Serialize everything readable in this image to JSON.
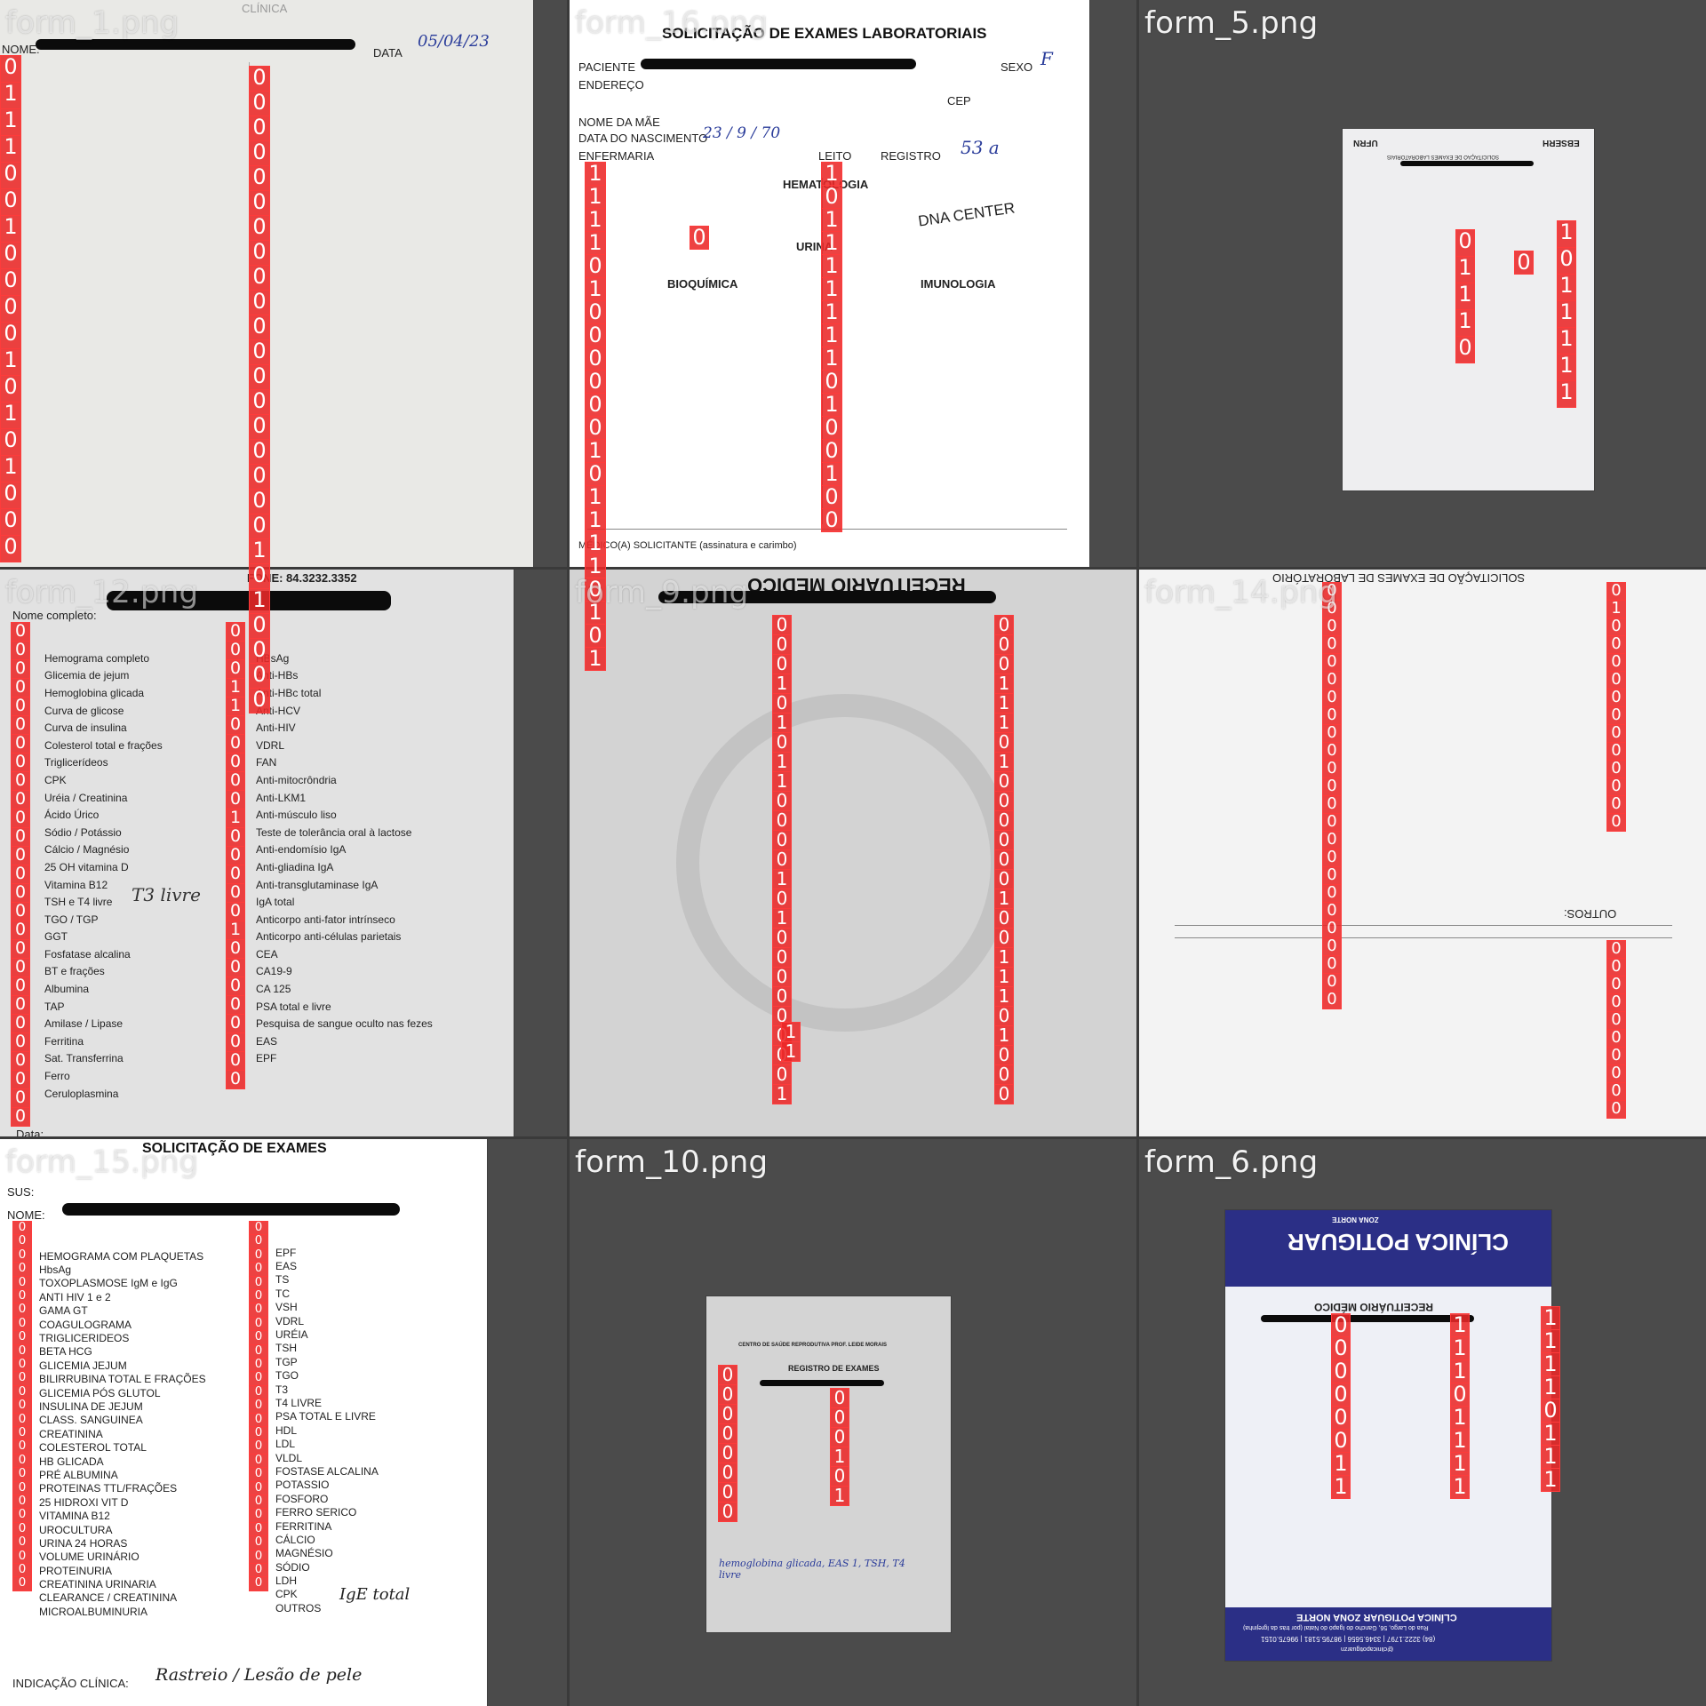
{
  "tiles": [
    {
      "name": "form_1.png",
      "header": {
        "name_label": "NOME:",
        "date_label": "DATA",
        "date_value": "05/04/23",
        "org": "CLÍNICA"
      }
    },
    {
      "name": "form_16.png",
      "title": "SOLICITAÇÃO DE EXAMES LABORATORIAIS",
      "fields": {
        "patient": "PACIENTE",
        "sex": "SEXO",
        "sex_value": "F",
        "address": "ENDEREÇO",
        "cep": "CEP",
        "mother": "NOME DA MÃE",
        "birth": "DATA DO NASCIMENTO",
        "birth_value": "23 / 9 / 70",
        "ward": "ENFERMARIA",
        "bed": "LEITO",
        "registry": "REGISTRO",
        "registry_value": "53 a"
      },
      "sections": [
        "HEMATOLOGIA",
        "URINA",
        "BIOQUÍMICA",
        "IMUNOLOGIA"
      ],
      "footer": "MÉDICO(A) SOLICITANTE (assinatura e carimbo)",
      "stamp": "DNA CENTER"
    },
    {
      "name": "form_5.png",
      "brand_left": "EBSERH",
      "brand_right": "UFRN",
      "title": "SOLICITAÇÃO DE EXAMES LABORATORIAIS"
    },
    {
      "name": "form_12.png",
      "phone": "FONE: 84.3232.3352",
      "name_label": "Nome completo:",
      "col1": [
        "Hemograma completo",
        "Glicemia de jejum",
        "Hemoglobina glicada",
        "Curva de glicose",
        "Curva de insulina",
        "Colesterol total e frações",
        "Triglicerídeos",
        "CPK",
        "Uréia / Creatinina",
        "Ácido Úrico",
        "Sódio / Potássio",
        "Cálcio / Magnésio",
        "25 OH vitamina D",
        "Vitamina B12",
        "TSH e T4 livre",
        "TGO / TGP",
        "GGT",
        "Fosfatase alcalina",
        "BT e frações",
        "Albumina",
        "TAP",
        "Amilase / Lipase",
        "Ferritina",
        "Sat. Transferrina",
        "Ferro",
        "Ceruloplasmina"
      ],
      "col2": [
        "HBsAg",
        "Anti-HBs",
        "Anti-HBc total",
        "Anti-HCV",
        "Anti-HIV",
        "VDRL",
        "FAN",
        "Anti-mitocrôndria",
        "Anti-LKM1",
        "Anti-músculo liso",
        "Teste de tolerância oral à lactose",
        "Anti-endomísio IgA",
        "Anti-gliadina IgA",
        "Anti-transglutaminase IgA",
        "IgA total",
        "Anticorpo anti-fator intrínseco",
        "Anticorpo anti-células parietais",
        "CEA",
        "CA19-9",
        "CA 125",
        "PSA total e livre",
        "Pesquisa de sangue oculto nas fezes",
        "EAS",
        "EPF"
      ],
      "handwritten": "T3 livre",
      "date_label": "Data:"
    },
    {
      "name": "form_9.png",
      "title": "RECEITUÁRIO MÉDICO"
    },
    {
      "name": "form_14.png",
      "title": "SOLICITAÇÃO DE EXAMES DE LABORATÓRIO",
      "others": "OUTROS:"
    },
    {
      "name": "form_15.png",
      "header": "SOLICITAÇÃO DE EXAMES",
      "sus": "SUS:",
      "name_label": "NOME:",
      "col1": [
        "HEMOGRAMA COM PLAQUETAS",
        "HbsAg",
        "TOXOPLASMOSE IgM e IgG",
        "ANTI HIV 1 e 2",
        "GAMA GT",
        "COAGULOGRAMA",
        "TRIGLICERIDEOS",
        "BETA HCG",
        "GLICEMIA JEJUM",
        "BILIRRUBINA TOTAL E FRAÇÕES",
        "GLICEMIA PÓS GLUTOL",
        "INSULINA DE JEJUM",
        "CLASS. SANGUINEA",
        "CREATININA",
        "COLESTEROL TOTAL",
        "HB GLICADA",
        "PRÉ ALBUMINA",
        "PROTEINAS TTL/FRAÇÕES",
        "25 HIDROXI VIT D",
        "VITAMINA B12",
        "UROCULTURA",
        "URINA 24 HORAS",
        "VOLUME URINÁRIO",
        "PROTEINURIA",
        "CREATININA URINARIA",
        "CLEARANCE / CREATININA",
        "MICROALBUMINURIA"
      ],
      "col2": [
        "EPF",
        "EAS",
        "TS",
        "TC",
        "VSH",
        "VDRL",
        "URÉIA",
        "TSH",
        "TGP",
        "TGO",
        "T3",
        "T4 LIVRE",
        "PSA TOTAL E LIVRE",
        "HDL",
        "LDL",
        "VLDL",
        "FOSTASE ALCALINA",
        "POTASSIO",
        "FOSFORO",
        "FERRO SERICO",
        "FERRITINA",
        "CÁLCIO",
        "MAGNÉSIO",
        "SÓDIO",
        "LDH",
        "CPK",
        "OUTROS"
      ],
      "others_value": "IgE total",
      "clinical_label": "INDICAÇÃO CLÍNICA:",
      "clinical_value": "Rastreio / Lesão de pele"
    },
    {
      "name": "form_10.png",
      "org": "CENTRO DE SAÚDE REPRODUTIVA PROF. LEIDE MORAIS",
      "title": "REGISTRO DE EXAMES",
      "handwritten": "hemoglobina glicada, EAS 1, TSH, T4 livre"
    },
    {
      "name": "form_6.png",
      "brand": "CLÍNICA POTIGUAR",
      "brand_sub": "ZONA NORTE",
      "title": "RECEITUÁRIO MÉDICO",
      "footer_brand": "CLÍNICA POTIGUAR ZONA NORTE",
      "footer_address": "Rua do Largo, 56, Gancho do Igapó do Natal (por trás da Igrejinha)",
      "footer_phones": "(84) 3222.1797 | 3346.5656 | 98795.5181 | 99675.0151",
      "footer_handle": "@clinicapotiguarzn"
    }
  ],
  "labels": {
    "zero": "0",
    "one": "1"
  },
  "colors": {
    "box": "#eb2828",
    "background": "#3a3a3a",
    "potiguar_blue": "#2b2f86"
  }
}
